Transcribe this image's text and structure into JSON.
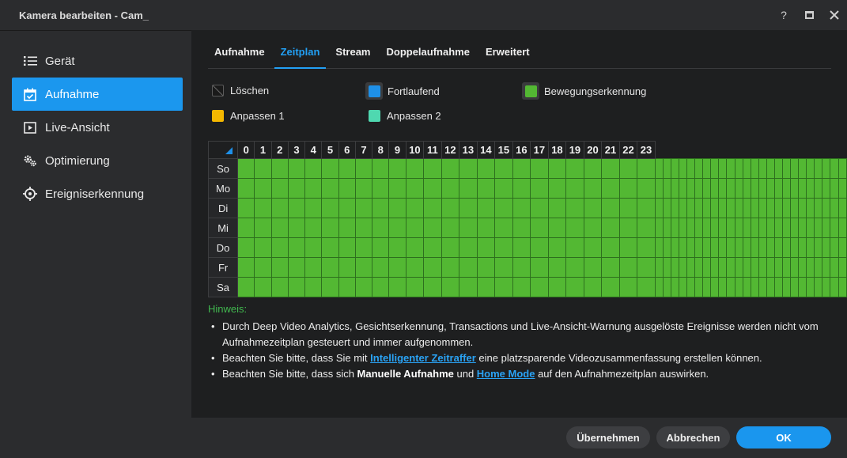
{
  "window": {
    "title": "Kamera bearbeiten - Cam_"
  },
  "sidebar": {
    "items": [
      {
        "label": "Gerät",
        "icon": "list-icon"
      },
      {
        "label": "Aufnahme",
        "icon": "calendar-check-icon",
        "active": true
      },
      {
        "label": "Live-Ansicht",
        "icon": "play-box-icon"
      },
      {
        "label": "Optimierung",
        "icon": "gears-icon"
      },
      {
        "label": "Ereigniserkennung",
        "icon": "crosshair-icon"
      }
    ]
  },
  "tabs": [
    {
      "label": "Aufnahme"
    },
    {
      "label": "Zeitplan",
      "active": true
    },
    {
      "label": "Stream"
    },
    {
      "label": "Doppelaufnahme"
    },
    {
      "label": "Erweitert"
    }
  ],
  "legend": {
    "delete": {
      "label": "Löschen"
    },
    "continuous": {
      "label": "Fortlaufend",
      "color": "#1e90e8"
    },
    "motion": {
      "label": "Bewegungserkennung",
      "color": "#53b833"
    },
    "custom1": {
      "label": "Anpassen 1",
      "color": "#f5b800"
    },
    "custom2": {
      "label": "Anpassen 2",
      "color": "#4fd8b0"
    }
  },
  "schedule": {
    "hours": [
      "0",
      "1",
      "2",
      "3",
      "4",
      "5",
      "6",
      "7",
      "8",
      "9",
      "10",
      "11",
      "12",
      "13",
      "14",
      "15",
      "16",
      "17",
      "18",
      "19",
      "20",
      "21",
      "22",
      "23"
    ],
    "days": [
      "So",
      "Mo",
      "Di",
      "Mi",
      "Do",
      "Fr",
      "Sa"
    ],
    "fill_mode": "Bewegungserkennung"
  },
  "notes": {
    "hint": "Hinweis:",
    "item1": "Durch Deep Video Analytics, Gesichtserkennung, Transactions und Live-Ansicht-Warnung ausgelöste Ereignisse werden nicht vom Aufnahmezeitplan gesteuert und immer aufgenommen.",
    "item2_pre": "Beachten Sie bitte, dass Sie mit ",
    "item2_link": "Intelligenter Zeitraffer",
    "item2_post": " eine platzsparende Videozusammenfassung erstellen können.",
    "item3_pre": "Beachten Sie bitte, dass sich ",
    "item3_bold": "Manuelle Aufnahme",
    "item3_mid": " und ",
    "item3_link": "Home Mode",
    "item3_post": " auf den Aufnahmezeitplan auswirken."
  },
  "footer": {
    "apply": "Übernehmen",
    "cancel": "Abbrechen",
    "ok": "OK"
  },
  "colors": {
    "accent": "#1b97ee",
    "hint": "#41b84f",
    "motion_green": "#53b833"
  }
}
